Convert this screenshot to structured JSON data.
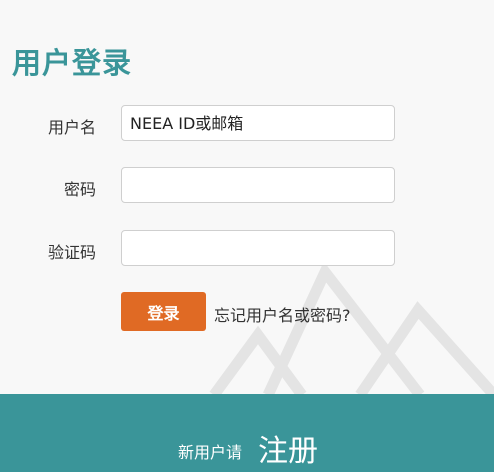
{
  "page": {
    "title": "用户登录"
  },
  "form": {
    "username_label": "用户名",
    "username_placeholder": "NEEA ID或邮箱",
    "password_label": "密码",
    "captcha_label": "验证码",
    "login_button": "登录",
    "forgot_link": "忘记用户名或密码?"
  },
  "footer": {
    "new_user_text": "新用户请",
    "register_link": "注册"
  },
  "colors": {
    "accent": "#3a9599",
    "button": "#e06a24"
  }
}
